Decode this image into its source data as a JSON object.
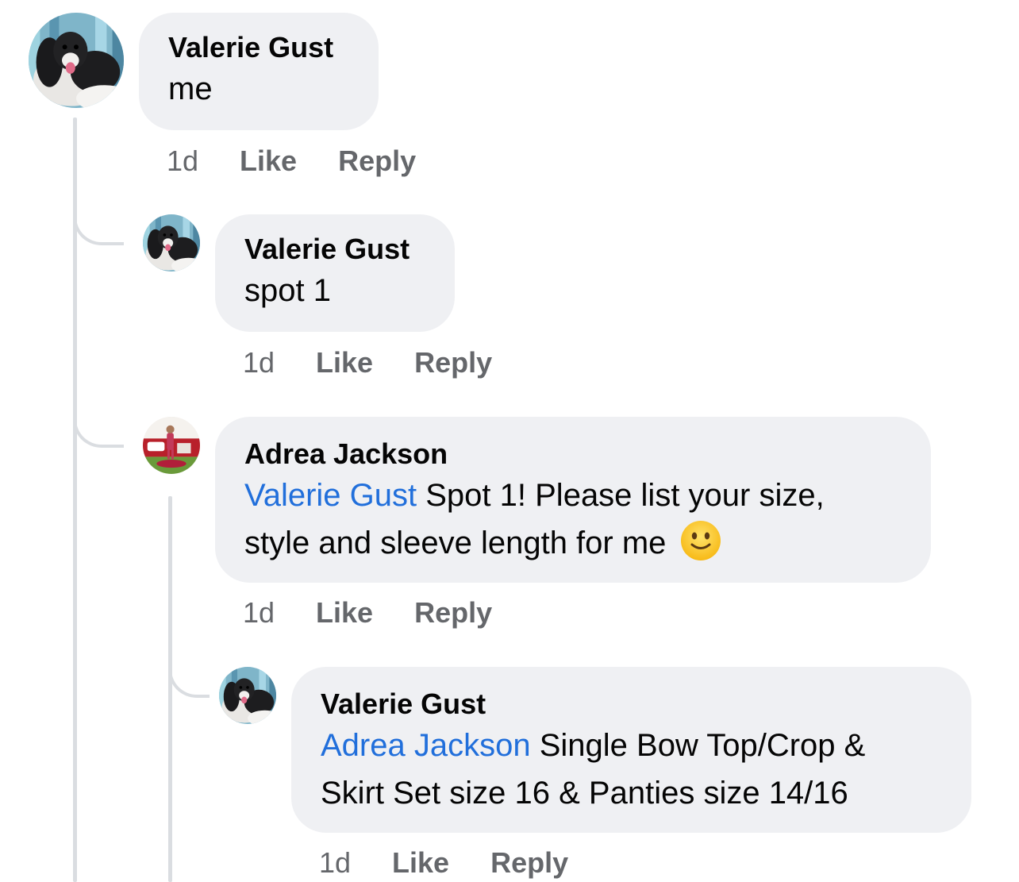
{
  "comments": [
    {
      "author": "Valerie Gust",
      "text": "me",
      "time": "1d",
      "like_label": "Like",
      "reply_label": "Reply"
    },
    {
      "author": "Valerie Gust",
      "text": "spot 1",
      "time": "1d",
      "like_label": "Like",
      "reply_label": "Reply"
    },
    {
      "author": "Adrea Jackson",
      "mention": "Valerie Gust",
      "text_line1": " Spot 1! Please list your size,",
      "text_line2": "style and sleeve length for me ",
      "emoji": "slightly-smiling-face-icon",
      "time": "1d",
      "like_label": "Like",
      "reply_label": "Reply"
    },
    {
      "author": "Valerie Gust",
      "mention": "Adrea Jackson",
      "text_line1": " Single Bow Top/Crop &",
      "text_line2": "Skirt Set size 16 & Panties size 14/16",
      "time": "1d",
      "like_label": "Like",
      "reply_label": "Reply"
    }
  ],
  "colors": {
    "bubble": "#eff0f3",
    "mention": "#216fdb",
    "meta": "#65676b",
    "thread_line": "#dadde1"
  }
}
